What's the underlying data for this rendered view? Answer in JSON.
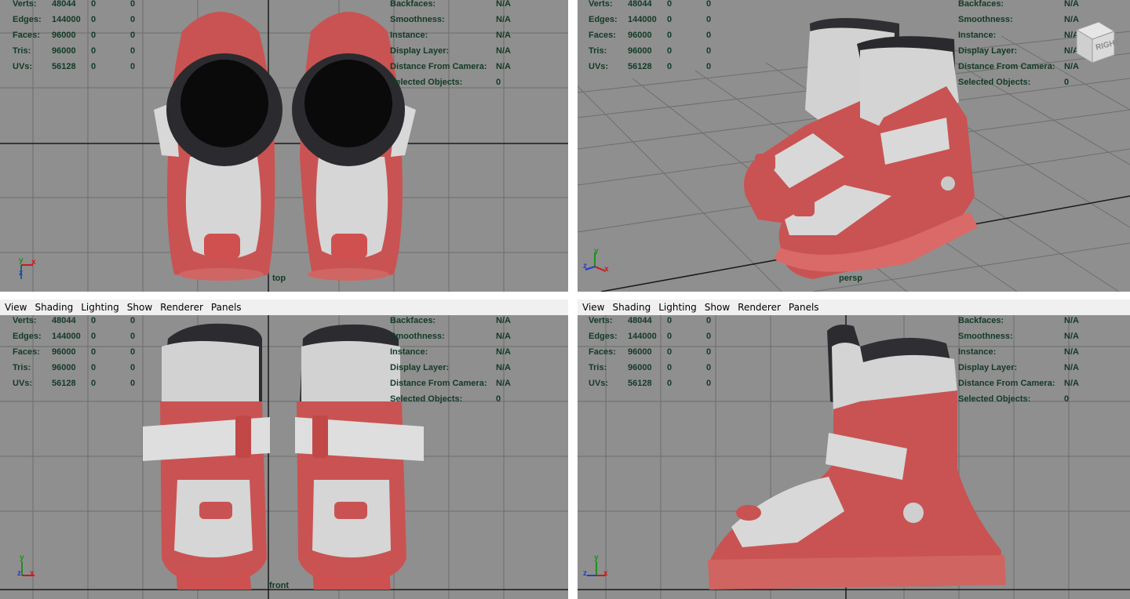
{
  "menu": [
    "View",
    "Shading",
    "Lighting",
    "Show",
    "Renderer",
    "Panels"
  ],
  "stats_left": [
    {
      "label": "Verts:",
      "v1": "48044",
      "v2": "0",
      "v3": "0"
    },
    {
      "label": "Edges:",
      "v1": "144000",
      "v2": "0",
      "v3": "0"
    },
    {
      "label": "Faces:",
      "v1": "96000",
      "v2": "0",
      "v3": "0"
    },
    {
      "label": "Tris:",
      "v1": "96000",
      "v2": "0",
      "v3": "0"
    },
    {
      "label": "UVs:",
      "v1": "56128",
      "v2": "0",
      "v3": "0"
    }
  ],
  "stats_right": [
    {
      "label": "Backfaces:",
      "value": "N/A"
    },
    {
      "label": "Smoothness:",
      "value": "N/A"
    },
    {
      "label": "Instance:",
      "value": "N/A"
    },
    {
      "label": "Display Layer:",
      "value": "N/A"
    },
    {
      "label": "Distance From Camera:",
      "value": "N/A"
    },
    {
      "label": "Selected Objects:",
      "value": "0"
    }
  ],
  "viewports": {
    "top": {
      "camera": "top"
    },
    "persp": {
      "camera": "persp",
      "viewcube_label": "RIGHT"
    },
    "front": {
      "camera": "front"
    },
    "side": {
      "camera": ""
    }
  },
  "axes": {
    "x": "x",
    "y": "y",
    "z": "z"
  },
  "colors": {
    "viewport_bg": "#8f8f8f",
    "grid": "#6e6e6e",
    "axis_line": "#1a1a1a",
    "boot_red": "#c95352",
    "boot_white": "#d6d6d6",
    "liner_dark": "#2b2b2f",
    "hud_text": "#123a26"
  }
}
